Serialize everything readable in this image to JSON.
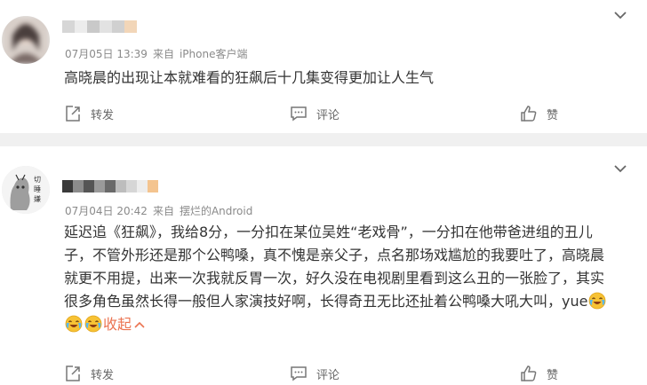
{
  "posts": [
    {
      "date": "07月05日 13:39",
      "source_prefix": "来自",
      "source": "iPhone客户端",
      "text": "高晓晨的出现让本就难看的狂飙后十几集变得更加让人生气",
      "actions": {
        "repost": "转发",
        "comment": "评论",
        "like": "赞"
      }
    },
    {
      "avatar_text": "切\n睡\n嫌",
      "date": "07月04日 20:42",
      "source_prefix": "来自",
      "source": "摆烂的Android",
      "text_lines": [
        "延迟追《狂飙》，我给8分，一分扣在某位吴姓“老戏骨”，一分扣在他带爸进组的丑儿",
        "子，不管外形还是那个公鸭嗓，真不愧是亲父子，点名那场戏尴尬的我要吐了，高晓晨",
        "就更不用提，出来一次我就反胃一次，好久没在电视剧里看到这么丑的一张脸了，其实",
        "很多角色虽然长得一般但人家演技好啊，长得奇丑无比还扯着公鸭嗓大吼大叫，yue"
      ],
      "collapse_label": "收起",
      "actions": {
        "repost": "转发",
        "comment": "评论",
        "like": "赞"
      }
    }
  ],
  "colors": {
    "accent": "#eb7350",
    "meta": "#8a8a8a",
    "separator": "#f0f0f0"
  },
  "icons": {
    "more": "chevron-down-icon",
    "repost": "repost-icon",
    "comment": "comment-icon",
    "like": "thumbs-up-icon",
    "emoji": "crying-laughing-emoji"
  }
}
